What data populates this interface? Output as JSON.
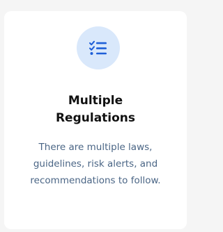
{
  "card": {
    "icon": "checklist-icon",
    "title_line1": "Multiple",
    "title_line2": "Regulations",
    "description": "There are multiple laws, guidelines, risk alerts, and recommendations to follow."
  },
  "colors": {
    "icon_background": "#d9e8fb",
    "icon_accent": "#1e5fd8",
    "title": "#111111",
    "description": "#4a6585",
    "card_background": "#ffffff",
    "page_background": "#f5f5f5"
  }
}
